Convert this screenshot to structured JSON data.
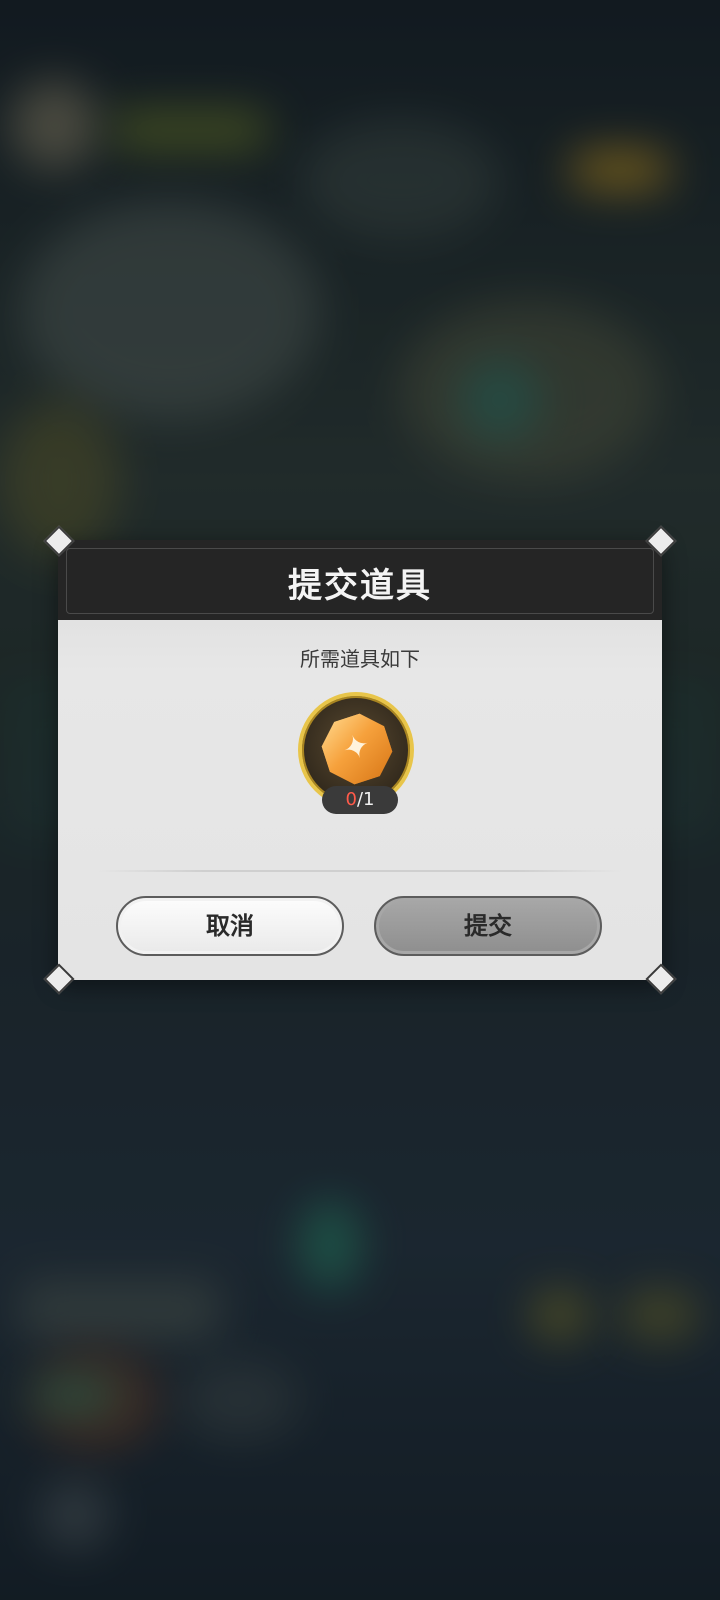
{
  "dialog": {
    "title": "提交道具",
    "subtitle": "所需道具如下",
    "item": {
      "icon": "orange-octagon-coin-icon",
      "owned": "0",
      "separator": "/",
      "required": "1"
    },
    "buttons": {
      "cancel": "取消",
      "submit": "提交"
    }
  },
  "colors": {
    "header_bg": "#252525",
    "panel_bg": "#e4e4e4",
    "count_have": "#ff5a4a",
    "slot_ring": "#e8c54a"
  }
}
